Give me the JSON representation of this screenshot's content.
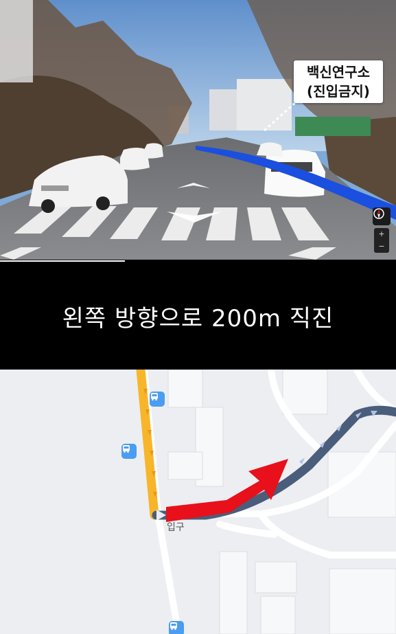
{
  "street_view": {
    "sign_line1": "백신연구소",
    "sign_line2": "(진입금지)",
    "zoom_in": "+",
    "zoom_out": "−"
  },
  "progress": {
    "value": 0.315
  },
  "instruction": {
    "text": "왼쪽 방향으로 200m 직진"
  },
  "map": {
    "place_label": "입구",
    "icons": {
      "bus_stop": "bus-stop-icon",
      "direction_arrow": "red-arrow-icon",
      "compass": "compass-icon"
    },
    "colors": {
      "route_yellow": "#f7b52a",
      "route_blue": "#4a5d7a",
      "arrow_red": "#e8101a",
      "bus_stop": "#4a9df0",
      "nav_line_blue": "#1a4fe0"
    }
  }
}
